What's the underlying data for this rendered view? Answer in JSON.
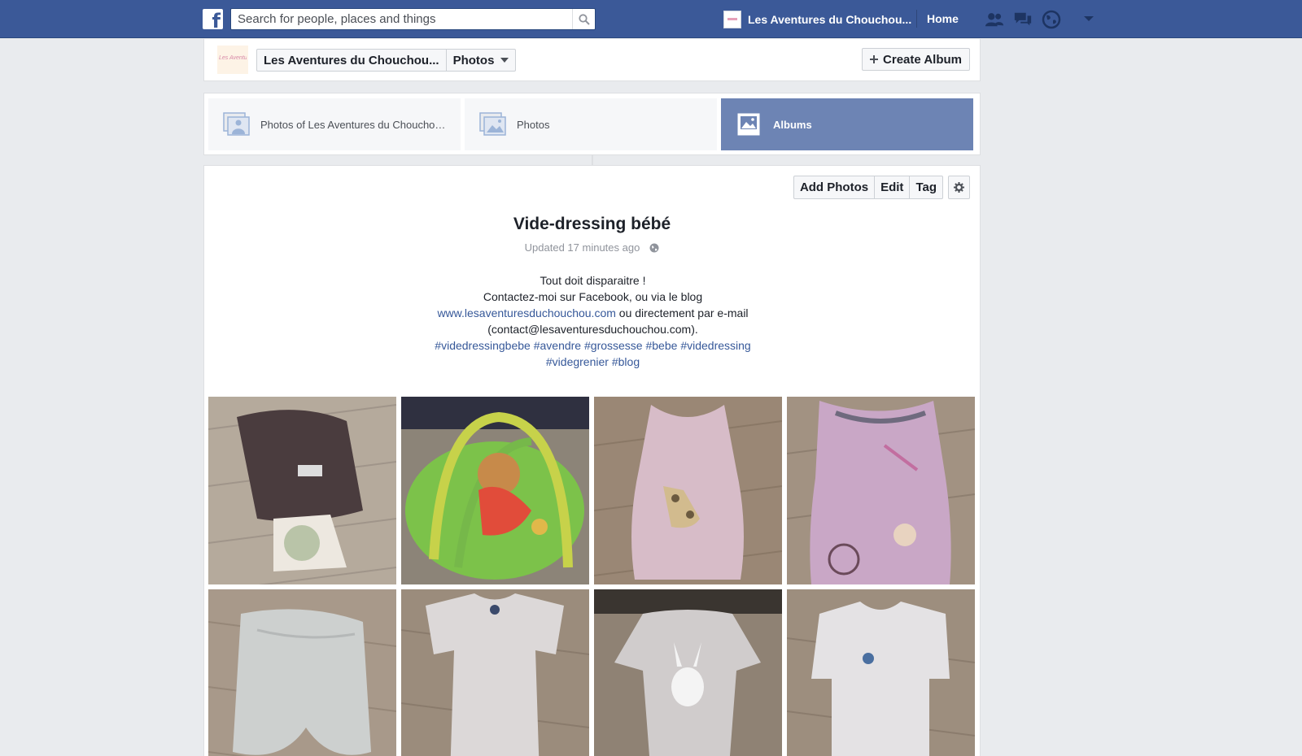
{
  "topbar": {
    "search_placeholder": "Search for people, places and things",
    "page_name": "Les Aventures du Chouchou...",
    "home_label": "Home",
    "icons": [
      "friend-requests-icon",
      "messages-icon",
      "notifications-globe-icon",
      "account-menu-caret-icon"
    ]
  },
  "pagebar": {
    "page_name": "Les Aventures du Chouchou...",
    "section": "Photos",
    "create_album_label": "Create Album"
  },
  "tabs": [
    {
      "label": "Photos of Les Aventures du Chouchou ...",
      "active": false
    },
    {
      "label": "Photos",
      "active": false
    },
    {
      "label": "Albums",
      "active": true
    }
  ],
  "album": {
    "add_photos_label": "Add Photos",
    "edit_label": "Edit",
    "tag_label": "Tag",
    "title": "Vide-dressing bébé",
    "updated": "Updated 17 minutes ago",
    "desc_line1": "Tout doit disparaitre !",
    "desc_line2": "Contactez-moi sur Facebook, ou via le blog",
    "desc_link": "www.lesaventuresduchouchou.com",
    "desc_line3_rest": " ou directement par e-mail",
    "desc_line4": "(contact@lesaventuresduchouchou.com).",
    "hashtags": [
      "#videdressingbebe",
      "#avendre",
      "#grossesse",
      "#bebe",
      "#videdressing",
      "#videgrenier",
      "#blog"
    ]
  },
  "colors": {
    "brand": "#3b5998",
    "active_tab": "#6d84b4",
    "link": "#365899"
  }
}
